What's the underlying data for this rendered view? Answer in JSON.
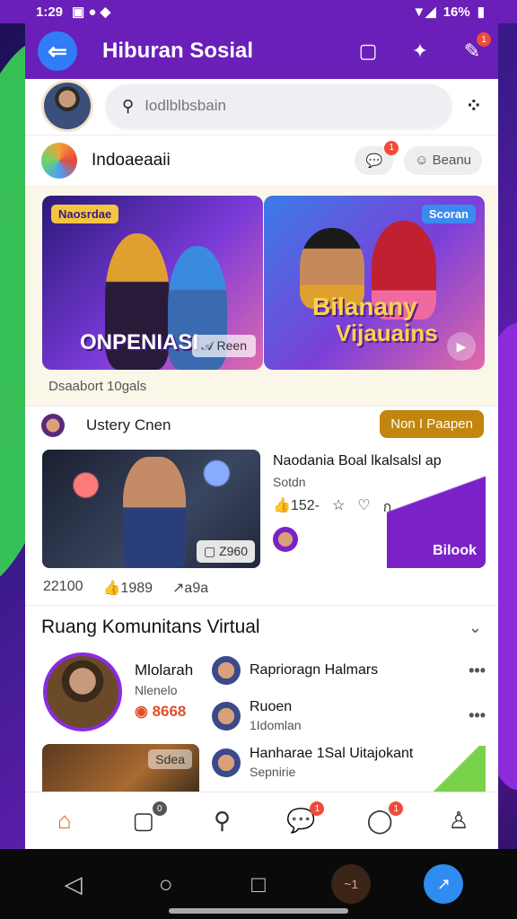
{
  "statusbar": {
    "time": "1:29",
    "battery": "16%"
  },
  "appbar": {
    "title": "Hiburan Sosial",
    "badge": "1"
  },
  "search": {
    "placeholder": "Iodlblbsbain"
  },
  "group": {
    "name": "Indoaeaaii",
    "chip_label": "Beanu",
    "chip_badge": "1"
  },
  "banner": {
    "card1_tag": "Naosrdae",
    "card1_text": "ONPENIASI",
    "card1_button": "Reen",
    "card2_tag": "Scoran",
    "card2_text_line1": "Bilanany",
    "card2_text_line2": "Vijauains",
    "footer": "Dsaabort 10gals"
  },
  "post": {
    "author": "Ustery Cnen",
    "tag_button": "Non I Paapen",
    "duration": "Z960",
    "title": "Naodania Boal lkalsalsl ap",
    "subtitle": "Sotdn",
    "actions": [
      "152-",
      "☆",
      "♡",
      "ก"
    ],
    "purple_label": "Bilook",
    "stats": [
      "22100",
      "1989",
      "a9a"
    ]
  },
  "community": {
    "title": "Ruang Komunitans Virtual",
    "main_name": "Mlolarah",
    "main_sub": "Nlenelo",
    "main_badge": "8668",
    "rows": [
      {
        "t1": "Raprioragn Halmars",
        "t2": ""
      },
      {
        "t1": "Ruoen",
        "t2": "1Idomlan"
      },
      {
        "t1": "Hanharae 1Sal Uitajokant",
        "t2": "Sepnirie"
      }
    ],
    "thumb_label": "Sdea"
  },
  "nav": {
    "badges": [
      "0",
      "1",
      "1"
    ]
  }
}
